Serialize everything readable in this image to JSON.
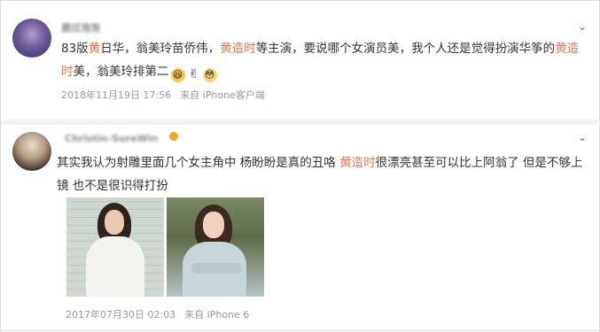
{
  "comments": [
    {
      "username": "鹿过泡泡",
      "text_parts": [
        {
          "t": "83版",
          "hl": false
        },
        {
          "t": "黄",
          "hl": true
        },
        {
          "t": "日华，翁美玲苗侨伟，",
          "hl": false
        },
        {
          "t": "黄造时",
          "hl": true
        },
        {
          "t": "等主演，要说哪个女演员美，我个人还是觉得扮演华筝的",
          "hl": false
        },
        {
          "t": "黄造时",
          "hl": true
        },
        {
          "t": "美，翁美玲排第二",
          "hl": false
        }
      ],
      "emojis": [
        "laughing-emoji",
        "victory-hand-emoji",
        "shy-emoji"
      ],
      "timestamp": "2018年11月19日 17:56",
      "source": "来自 iPhone客户端"
    },
    {
      "username": "Christin-SureWin",
      "text_parts": [
        {
          "t": "其实我认为射雕里面几个女主角中 杨盼盼是真的丑咯 ",
          "hl": false
        },
        {
          "t": "黄造时",
          "hl": true
        },
        {
          "t": "很漂亮甚至可以比上阿翁了 但是不够上镜 也不是很识得打扮",
          "hl": false
        }
      ],
      "timestamp": "2017年07月30日 02:03",
      "source": "来自 iPhone 6"
    }
  ],
  "colors": {
    "highlight": "#eb7350",
    "meta": "#999999",
    "text": "#333333"
  }
}
